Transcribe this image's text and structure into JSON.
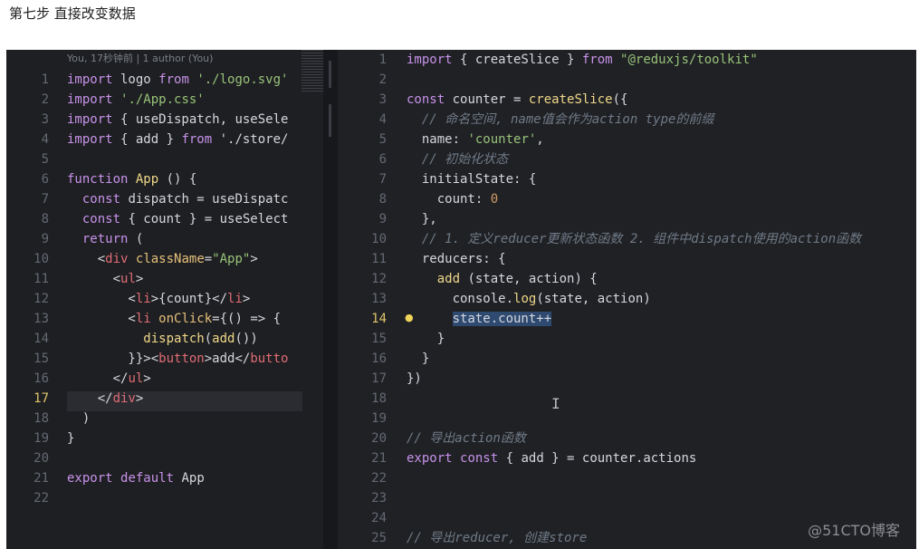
{
  "heading": "第七步 直接改变数据",
  "left_pane": {
    "blame": "You, 17秒钟前 | 1 author (You)",
    "current_line": "17",
    "lines": [
      {
        "n": "1",
        "text": "import logo from './logo.svg'"
      },
      {
        "n": "2",
        "text": "import './App.css'"
      },
      {
        "n": "3",
        "text": "import { useDispatch, useSele"
      },
      {
        "n": "4",
        "text": "import { add } from './store/"
      },
      {
        "n": "5",
        "text": ""
      },
      {
        "n": "6",
        "text": "function App () {"
      },
      {
        "n": "7",
        "text": "  const dispatch = useDispatc"
      },
      {
        "n": "8",
        "text": "  const { count } = useSelect"
      },
      {
        "n": "9",
        "text": "  return ("
      },
      {
        "n": "10",
        "text": "    <div className=\"App\">"
      },
      {
        "n": "11",
        "text": "      <ul>"
      },
      {
        "n": "12",
        "text": "        <li>{count}</li>"
      },
      {
        "n": "13",
        "text": "        <li onClick={() => {"
      },
      {
        "n": "14",
        "text": "          dispatch(add())"
      },
      {
        "n": "15",
        "text": "        }}><button>add</butto"
      },
      {
        "n": "16",
        "text": "      </ul>"
      },
      {
        "n": "17",
        "text": "    </div>"
      },
      {
        "n": "18",
        "text": "  )"
      },
      {
        "n": "19",
        "text": "}"
      },
      {
        "n": "20",
        "text": ""
      },
      {
        "n": "21",
        "text": "export default App"
      },
      {
        "n": "22",
        "text": ""
      }
    ]
  },
  "right_pane": {
    "current_line": "14",
    "lines": [
      {
        "n": "1",
        "text": "import { createSlice } from \"@reduxjs/toolkit\""
      },
      {
        "n": "2",
        "text": ""
      },
      {
        "n": "3",
        "text": "const counter = createSlice({"
      },
      {
        "n": "4",
        "text": "  // 命名空间, name值会作为action type的前缀"
      },
      {
        "n": "5",
        "text": "  name: 'counter',"
      },
      {
        "n": "6",
        "text": "  // 初始化状态"
      },
      {
        "n": "7",
        "text": "  initialState: {"
      },
      {
        "n": "8",
        "text": "    count: 0"
      },
      {
        "n": "9",
        "text": "  },"
      },
      {
        "n": "10",
        "text": "  // 1. 定义reducer更新状态函数 2. 组件中dispatch使用的action函数"
      },
      {
        "n": "11",
        "text": "  reducers: {"
      },
      {
        "n": "12",
        "text": "    add (state, action) {"
      },
      {
        "n": "13",
        "text": "      console.log(state, action)"
      },
      {
        "n": "14",
        "text": "      state.count++"
      },
      {
        "n": "15",
        "text": "    }"
      },
      {
        "n": "16",
        "text": "  }"
      },
      {
        "n": "17",
        "text": "})"
      },
      {
        "n": "18",
        "text": ""
      },
      {
        "n": "19",
        "text": ""
      },
      {
        "n": "20",
        "text": "// 导出action函数"
      },
      {
        "n": "21",
        "text": "export const { add } = counter.actions"
      },
      {
        "n": "22",
        "text": ""
      },
      {
        "n": "23",
        "text": ""
      },
      {
        "n": "24",
        "text": ""
      },
      {
        "n": "25",
        "text": "// 导出reducer, 创建store"
      }
    ]
  },
  "watermark": "@51CTO博客"
}
